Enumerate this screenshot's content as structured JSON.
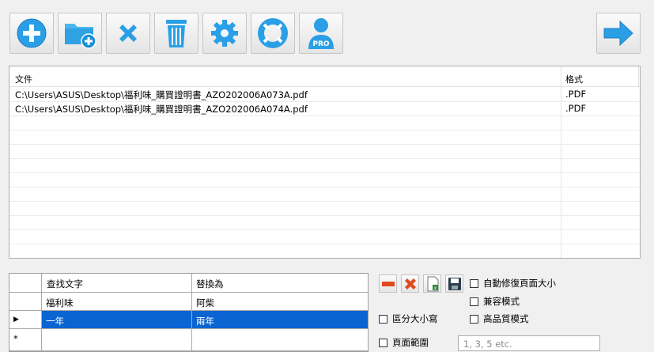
{
  "toolbar": {
    "buttons": [
      {
        "name": "add-file-button",
        "icon": "plus-circle-icon"
      },
      {
        "name": "add-folder-button",
        "icon": "folder-plus-icon"
      },
      {
        "name": "remove-button",
        "icon": "x-icon"
      },
      {
        "name": "clear-button",
        "icon": "trash-icon"
      },
      {
        "name": "settings-button",
        "icon": "gear-icon"
      },
      {
        "name": "help-button",
        "icon": "lifebuoy-icon"
      },
      {
        "name": "pro-button",
        "icon": "user-pro-icon",
        "badge": "PRO"
      }
    ],
    "next_icon": "arrow-right-icon"
  },
  "files": {
    "col_file": "文件",
    "col_format": "格式",
    "rows": [
      {
        "path": "C:\\Users\\ASUS\\Desktop\\福利味_購買證明書_AZO202006A073A.pdf",
        "format": ".PDF"
      },
      {
        "path": "C:\\Users\\ASUS\\Desktop\\福利味_購買證明書_AZO202006A074A.pdf",
        "format": ".PDF"
      }
    ]
  },
  "replace": {
    "col_find": "查找文字",
    "col_replace": "替換為",
    "rows": [
      {
        "marker": "",
        "find": "福利味",
        "replace": "阿柴"
      },
      {
        "marker": "▶",
        "find": "一年",
        "replace": "兩年"
      },
      {
        "marker": "*",
        "find": "",
        "replace": ""
      }
    ]
  },
  "options": {
    "auto_fix_page_size": "自動修復頁面大小",
    "compat_mode": "兼容模式",
    "high_quality": "高品質模式",
    "case_sensitive": "區分大小寫",
    "page_range_label": "頁面範圍",
    "page_range_placeholder": "1, 3, 5 etc."
  },
  "colors": {
    "accent": "#0a64d2",
    "icon_blue": "#2a9fe6"
  }
}
